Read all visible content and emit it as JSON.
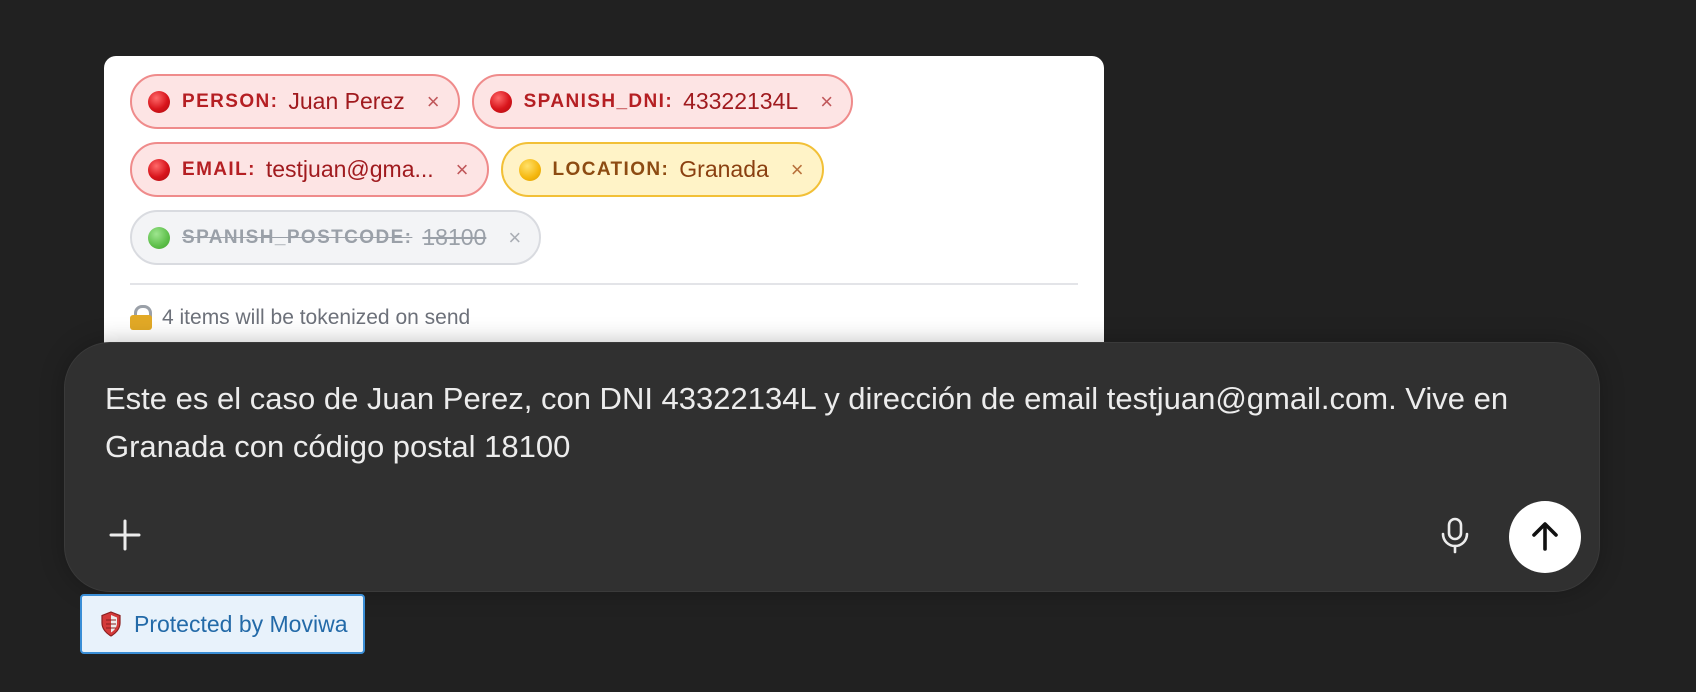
{
  "pii_panel": {
    "chips": [
      {
        "key": "PERSON:",
        "value": "Juan Perez",
        "level": "red"
      },
      {
        "key": "SPANISH_DNI:",
        "value": "43322134L",
        "level": "red"
      },
      {
        "key": "EMAIL:",
        "value": "testjuan@gma...",
        "level": "red"
      },
      {
        "key": "LOCATION:",
        "value": "Granada",
        "level": "yellow"
      },
      {
        "key": "SPANISH_POSTCODE:",
        "value": "18100",
        "level": "green",
        "struck": true
      }
    ],
    "remove_symbol": "×",
    "footer_text": "4 items will be tokenized on send",
    "colors": {
      "red": "#d8141b",
      "yellow": "#f5b70d",
      "green": "#5dbf4a"
    }
  },
  "composer": {
    "text": "Este es el caso de Juan Perez, con DNI 43322134L y dirección de email testjuan@gmail.com. Vive en Granada con código postal 18100",
    "icons": {
      "add": "plus-icon",
      "mic": "microphone-icon",
      "send": "arrow-up-icon"
    }
  },
  "badge": {
    "label": "Protected by Moviwa",
    "icon": "shield-icon"
  }
}
